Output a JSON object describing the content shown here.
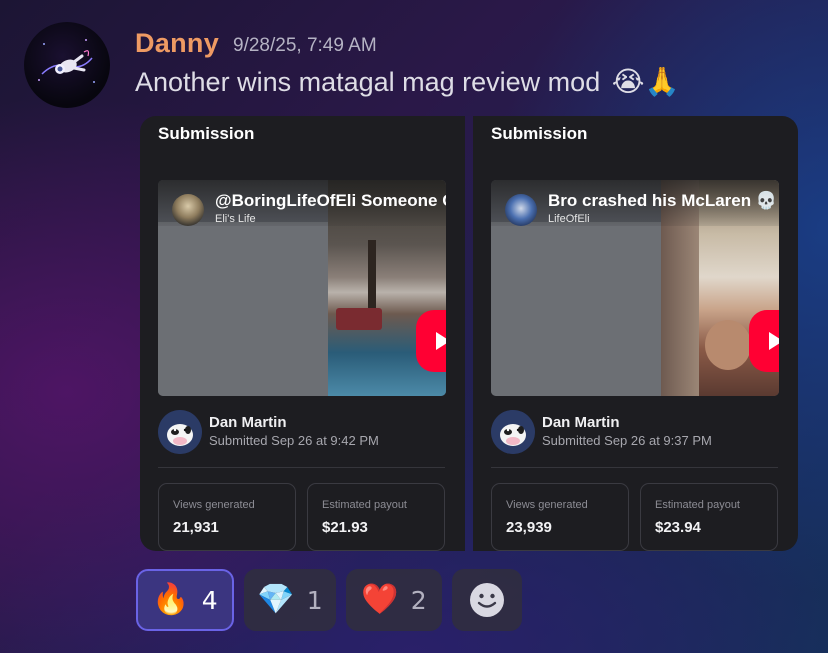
{
  "message": {
    "username": "Danny",
    "timestamp": "9/28/25, 7:49 AM",
    "text": "Another wins matagal mag review mod",
    "text_emojis": "😭🙏"
  },
  "cards": [
    {
      "title": "Submission",
      "video_title": "@BoringLifeOfEli Someone C",
      "channel": "Eli's Life",
      "submitter_name": "Dan Martin",
      "submitted": "Submitted Sep 26 at 9:42 PM",
      "views_label": "Views generated",
      "views_value": "21,931",
      "payout_label": "Estimated payout",
      "payout_value": "$21.93"
    },
    {
      "title": "Submission",
      "video_title": "Bro crashed his McLaren 💀",
      "channel": "LifeOfEli",
      "submitter_name": "Dan Martin",
      "submitted": "Submitted Sep 26 at 9:37 PM",
      "views_label": "Views generated",
      "views_value": "23,939",
      "payout_label": "Estimated payout",
      "payout_value": "$23.94"
    }
  ],
  "reactions": [
    {
      "emoji": "🔥",
      "count": "4",
      "active": true
    },
    {
      "emoji": "💎",
      "count": "1",
      "active": false
    },
    {
      "emoji": "❤️",
      "count": "2",
      "active": false
    },
    {
      "icon": "add-reaction-icon"
    }
  ],
  "colors": {
    "username": "#ee9a63",
    "card_bg": "#1d1d21",
    "active_reaction": "#3b3580",
    "youtube_red": "#ff0033"
  }
}
